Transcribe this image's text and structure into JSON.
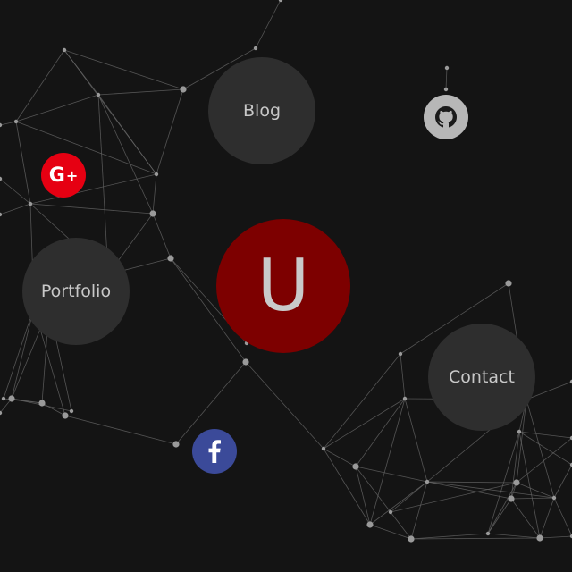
{
  "colors": {
    "background": "#141414",
    "bubble": "#2e2e2e",
    "bubble_text": "#c8c8c8",
    "logo_bg": "#7d0000",
    "logo_text": "#c9c9c9",
    "google_plus": "#e60012",
    "github": "#b7b7b7",
    "facebook": "#3b4a99",
    "network_line": "#6a6a6a",
    "network_node": "#9a9a9a"
  },
  "logo": {
    "letter": "U"
  },
  "nav": {
    "blog_label": "Blog",
    "portfolio_label": "Portfolio",
    "contact_label": "Contact"
  },
  "social": {
    "google_plus_icon": "google-plus-icon",
    "github_icon": "github-icon",
    "facebook_icon": "facebook-icon"
  }
}
